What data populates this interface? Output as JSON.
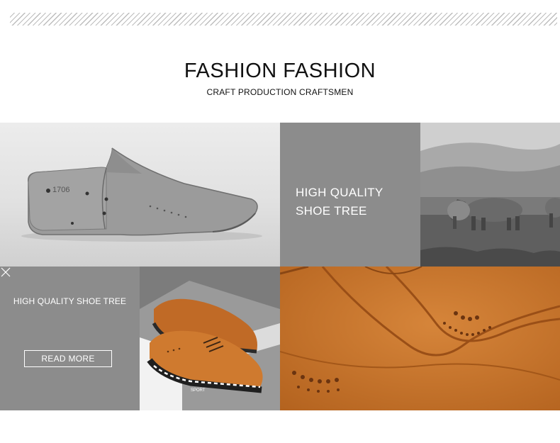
{
  "header": {
    "title": "FASHION FASHION",
    "subtitle": "CRAFT PRODUCTION CRAFTSMEN"
  },
  "tiles": {
    "shoe_last": {
      "stamp": "1706"
    },
    "grey_top": {
      "line1": "HIGH QUALITY",
      "line2": "SHOE TREE"
    },
    "grey_bottom": {
      "title": "HIGH QUALITY SHOE TREE",
      "close_icon": "close-icon",
      "button_label": "READ MORE"
    },
    "shoe_photo": {
      "sole_text": "SPORT"
    }
  },
  "colors": {
    "panel_grey": "#8c8c8c",
    "suede": "#c8752d",
    "text_dark": "#111111"
  }
}
